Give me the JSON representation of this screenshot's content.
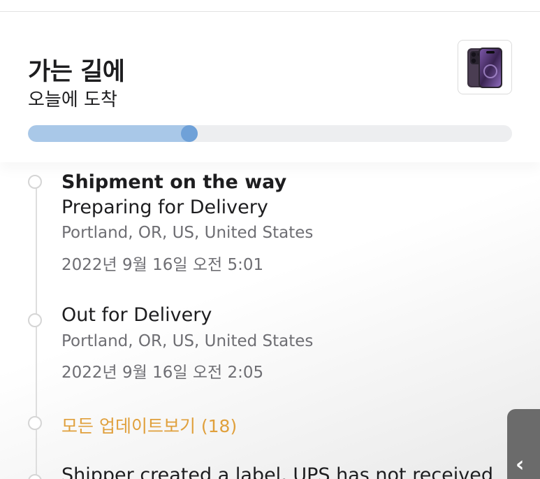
{
  "status": {
    "title": "가는 길에",
    "subtitle": "오늘에 도착"
  },
  "progress": {
    "fraction": 0.35,
    "track_color": "#edeef0",
    "fill_color": "#a9c8e8",
    "knob_color": "#6fa1d8"
  },
  "product": {
    "icon": "iphone-14-pro-deep-purple-image"
  },
  "timeline": {
    "events": [
      {
        "heading": "Shipment on the way",
        "title": "Preparing for Delivery",
        "location": "Portland, OR, US, United States",
        "datetime": "2022년 9월 16일  오전 5:01"
      },
      {
        "title": "Out for Delivery",
        "location": "Portland, OR, US, United States",
        "datetime": "2022년 9월 16일  오전 2:05"
      }
    ],
    "see_all_label": "모든 업데이트보기 (18)",
    "next_event_partial": "Shipper created a label, UPS has not received"
  },
  "side_tab": {
    "glyph": "‹"
  },
  "colors": {
    "link": "#e0a03c",
    "meta_text": "#6e6e73"
  }
}
